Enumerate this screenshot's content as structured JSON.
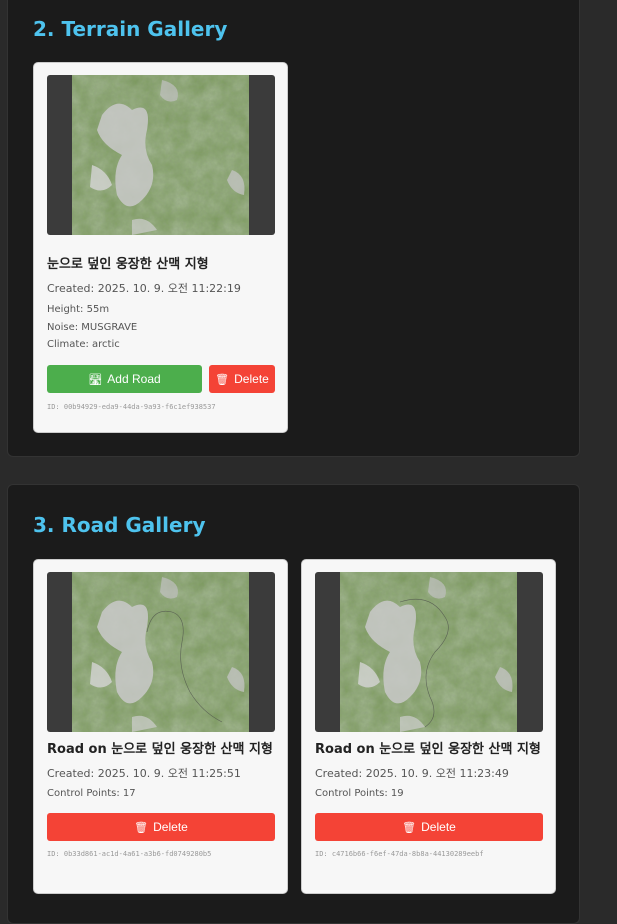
{
  "terrain_gallery": {
    "title": "2. Terrain Gallery",
    "cards": [
      {
        "title": "눈으로 덮인 웅장한 산맥 지형",
        "created": "Created: 2025. 10. 9. 오전 11:22:19",
        "height": "Height: 55m",
        "noise": "Noise: MUSGRAVE",
        "climate": "Climate: arctic",
        "add_road_label": "Add Road",
        "delete_label": "Delete",
        "id": "ID: 00b94929-eda9-44da-9a93-f6c1ef938537"
      }
    ]
  },
  "road_gallery": {
    "title": "3. Road Gallery",
    "cards": [
      {
        "title": "Road on 눈으로 덮인 웅장한 산맥 지형",
        "created": "Created: 2025. 10. 9. 오전 11:25:51",
        "control_points": "Control Points: 17",
        "delete_label": "Delete",
        "id": "ID: 0b33d861-ac1d-4a61-a3b6-fd0749280b5"
      },
      {
        "title": "Road on 눈으로 덮인 웅장한 산맥 지형",
        "created": "Created: 2025. 10. 9. 오전 11:23:49",
        "control_points": "Control Points: 19",
        "delete_label": "Delete",
        "id": "ID: c4716b66-f6ef-47da-8b8a-44130289eebf"
      }
    ]
  },
  "colors": {
    "accent": "#4ec3ee",
    "add_button": "#4cae4c",
    "delete_button": "#f44336"
  },
  "icons": {
    "add_road": "road-icon",
    "delete": "wastebasket-icon"
  }
}
